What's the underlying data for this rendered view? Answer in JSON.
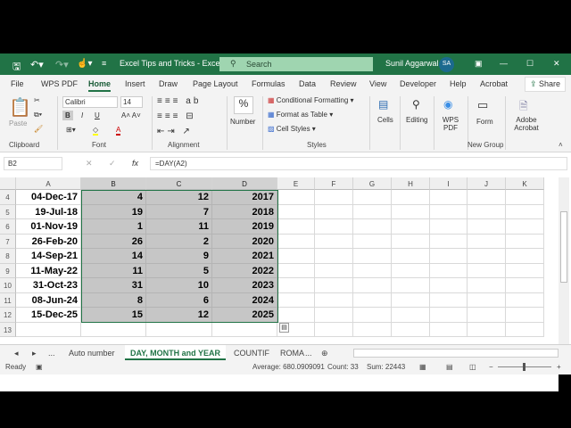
{
  "title_bar": {
    "doc_title": "Excel Tips and Tricks  -  Excel",
    "search_placeholder": "Search",
    "user": "Sunil Aggarwal",
    "avatar": "SA"
  },
  "ribbon_tabs": [
    "File",
    "WPS PDF",
    "Home",
    "Insert",
    "Draw",
    "Page Layout",
    "Formulas",
    "Data",
    "Review",
    "View",
    "Developer",
    "Help",
    "Acrobat"
  ],
  "active_tab": "Home",
  "share": "Share",
  "ribbon": {
    "paste": "Paste",
    "font_name": "Calibri",
    "font_size": "14",
    "bold": "B",
    "italic": "I",
    "underline": "U",
    "number": "Number",
    "cond_format": "Conditional Formatting",
    "format_table": "Format as Table",
    "cell_styles": "Cell Styles",
    "cells": "Cells",
    "editing": "Editing",
    "wps_pdf": "WPS PDF",
    "form": "Form",
    "adobe": "Adobe Acrobat",
    "groups": {
      "clipboard": "Clipboard",
      "font": "Font",
      "alignment": "Alignment",
      "styles": "Styles",
      "new_group": "New Group"
    }
  },
  "formula_bar": {
    "name_box": "B2",
    "formula": "=DAY(A2)",
    "fx": "fx"
  },
  "columns": [
    "A",
    "B",
    "C",
    "D",
    "E",
    "F",
    "G",
    "H",
    "I",
    "J",
    "K"
  ],
  "rows": [
    {
      "n": "4",
      "cells": [
        "04-Dec-17",
        "4",
        "12",
        "2017"
      ]
    },
    {
      "n": "5",
      "cells": [
        "19-Jul-18",
        "19",
        "7",
        "2018"
      ]
    },
    {
      "n": "6",
      "cells": [
        "01-Nov-19",
        "1",
        "11",
        "2019"
      ]
    },
    {
      "n": "7",
      "cells": [
        "26-Feb-20",
        "26",
        "2",
        "2020"
      ]
    },
    {
      "n": "8",
      "cells": [
        "14-Sep-21",
        "14",
        "9",
        "2021"
      ]
    },
    {
      "n": "9",
      "cells": [
        "11-May-22",
        "11",
        "5",
        "2022"
      ]
    },
    {
      "n": "10",
      "cells": [
        "31-Oct-23",
        "31",
        "10",
        "2023"
      ]
    },
    {
      "n": "11",
      "cells": [
        "08-Jun-24",
        "8",
        "6",
        "2024"
      ]
    },
    {
      "n": "12",
      "cells": [
        "15-Dec-25",
        "15",
        "12",
        "2025"
      ]
    },
    {
      "n": "13",
      "cells": [
        "",
        "",
        "",
        ""
      ]
    }
  ],
  "sheet_tabs": [
    "Auto number",
    "DAY, MONTH and YEAR",
    "COUNTIF",
    "ROMA"
  ],
  "active_sheet": "DAY, MONTH and YEAR",
  "more_tabs": "...",
  "status": {
    "ready": "Ready",
    "average": "Average: 680.0909091",
    "count": "Count: 33",
    "sum": "Sum: 22443"
  },
  "colors": {
    "accent": "#217346",
    "selection": "#c6c6c6"
  }
}
